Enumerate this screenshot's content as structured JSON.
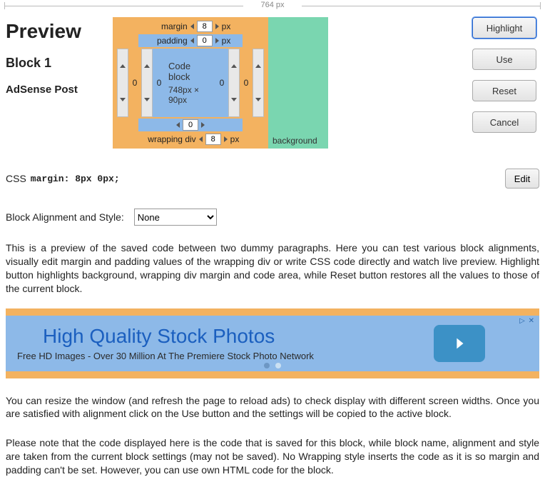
{
  "ruler_label": "764 px",
  "titles": {
    "preview": "Preview",
    "block": "Block 1",
    "name": "AdSense Post"
  },
  "boxmodel": {
    "margin_label": "margin",
    "padding_label": "padding",
    "wrapping_label": "wrapping div",
    "background_label": "background",
    "unit": "px",
    "margin_top": "8",
    "margin_bottom": "8",
    "margin_left": "0",
    "margin_right": "0",
    "padding_top": "0",
    "padding_bottom": "0",
    "padding_left": "0",
    "padding_right": "0",
    "code_label": "Code block",
    "code_size": "748px × 90px"
  },
  "buttons": {
    "highlight": "Highlight",
    "use": "Use",
    "reset": "Reset",
    "cancel": "Cancel",
    "edit": "Edit"
  },
  "css": {
    "label": "CSS",
    "value": "margin: 8px 0px;"
  },
  "align": {
    "label": "Block Alignment and Style:",
    "selected": "None",
    "options": [
      "None"
    ]
  },
  "paragraphs": {
    "p1": "This is a preview of the saved code between two dummy paragraphs. Here you can test various block alignments, visually edit margin and padding values of the wrapping div or write CSS code directly and watch live preview. Highlight button highlights background, wrapping div margin and code area, while Reset button restores all the values to those of the current block.",
    "p2": "You can resize the window (and refresh the page to reload ads) to check display with different screen widths. Once you are satisfied with alignment click on the Use button and the settings will be copied to the active block.",
    "p3": "Please note that the code displayed here is the code that is saved for this block, while block name, alignment and style are taken from the current block settings (may not be saved). No Wrapping style inserts the code as it is so margin and padding can't be set. However, you can use own HTML code for the block."
  },
  "ad": {
    "title": "High Quality Stock Photos",
    "sub": "Free HD Images - Over 30 Million At The Premiere Stock Photo Network",
    "close": "▷ ✕"
  }
}
